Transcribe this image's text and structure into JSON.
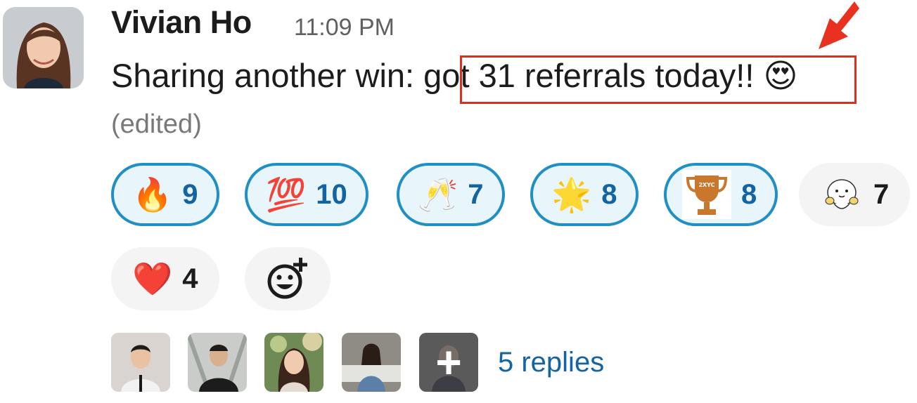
{
  "message": {
    "author": "Vivian Ho",
    "time": "11:09 PM",
    "text_before": "Sharing another win:",
    "text_highlighted": "got 31 referrals today!!",
    "text_emoji": "😍",
    "edited_label": "(edited)"
  },
  "reactions": [
    {
      "emoji": "🔥",
      "count": "9",
      "active": true
    },
    {
      "emoji": "💯",
      "count": "10",
      "active": true
    },
    {
      "emoji": "🥂",
      "count": "7",
      "active": true
    },
    {
      "emoji": "🌟",
      "count": "8",
      "active": true
    },
    {
      "emoji": "trophy-custom",
      "count": "8",
      "active": true,
      "badge_text": "2XYC"
    },
    {
      "emoji": "cute-ghost-custom",
      "count": "7",
      "active": false
    },
    {
      "emoji": "❤️",
      "count": "4",
      "active": false
    }
  ],
  "replies": {
    "label": "5 replies",
    "more_icon": "+"
  },
  "colors": {
    "active_chip_bg": "#e8f5fa",
    "active_chip_border": "#1f8fc4",
    "active_count": "#1264a3",
    "highlight_border": "#d93025"
  }
}
